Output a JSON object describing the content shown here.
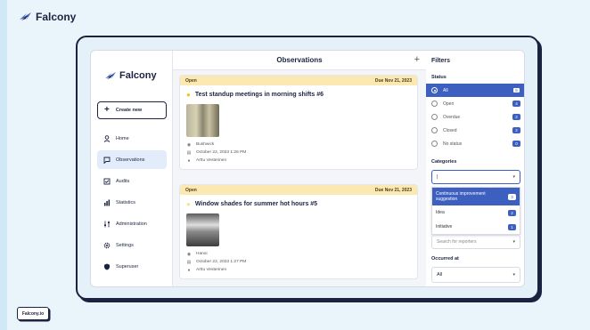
{
  "brand": {
    "name": "Falcony",
    "accent": "#3d5fc0",
    "dark": "#1b2340"
  },
  "sidebar": {
    "logo": "Falcony",
    "create_label": "Create new",
    "items": [
      {
        "label": "Home",
        "icon": "person-icon"
      },
      {
        "label": "Observations",
        "icon": "chat-icon",
        "active": true
      },
      {
        "label": "Audits",
        "icon": "checkbox-icon"
      },
      {
        "label": "Statistics",
        "icon": "bar-chart-icon"
      },
      {
        "label": "Administration",
        "icon": "sliders-icon"
      },
      {
        "label": "Settings",
        "icon": "gear-icon"
      },
      {
        "label": "Superuser",
        "icon": "shield-icon"
      }
    ]
  },
  "main": {
    "title": "Observations",
    "add_icon": "plus-icon",
    "cards": [
      {
        "status": "Open",
        "due": "Due Nov 21, 2023",
        "title": "Test standup meetings in morning shifts #6",
        "location": "Bushwick",
        "date": "October 22, 2023 1:26 PM",
        "reporter": "Arttu Vesterinen"
      },
      {
        "status": "Open",
        "due": "Due Nov 21, 2023",
        "title": "Window shades for summer hot hours #5",
        "location": "Hanoi",
        "date": "October 22, 2023 1:27 PM",
        "reporter": "Arttu Vesterinen"
      }
    ]
  },
  "filters": {
    "title": "Filters",
    "status_label": "Status",
    "status": [
      {
        "label": "All",
        "count": "5",
        "active": true
      },
      {
        "label": "Open",
        "count": "4"
      },
      {
        "label": "Overdue",
        "count": "2"
      },
      {
        "label": "Closed",
        "count": "2"
      },
      {
        "label": "No status",
        "count": "0"
      }
    ],
    "categories_label": "Categories",
    "categories_value": "|",
    "categories_options": [
      {
        "label": "Continuous improvement suggestion",
        "count": "3",
        "active": true
      },
      {
        "label": "Idea",
        "count": "2"
      },
      {
        "label": "Initiative",
        "count": "1"
      }
    ],
    "reporters_placeholder": "Search for reporters",
    "occurred_label": "Occurred at",
    "occurred_value": "All"
  },
  "footer": {
    "site": "Falcony.io"
  }
}
